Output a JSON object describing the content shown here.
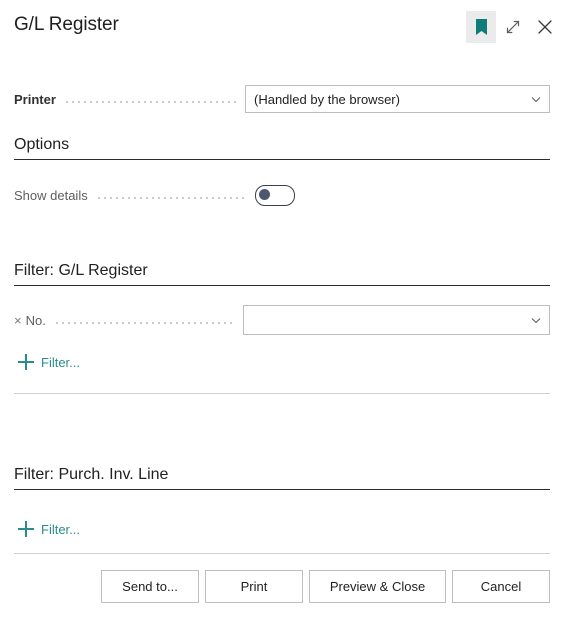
{
  "window": {
    "title": "G/L Register",
    "actions": [
      {
        "name": "bookmark-icon",
        "label": "Bookmark"
      },
      {
        "name": "expand-icon",
        "label": "Expand"
      },
      {
        "name": "close-icon",
        "label": "Close"
      }
    ]
  },
  "printer": {
    "label": "Printer",
    "value": "(Handled by the browser)"
  },
  "options": {
    "heading": "Options",
    "show_details": {
      "label": "Show details",
      "state": "off"
    }
  },
  "filter_gl_register": {
    "heading": "Filter: G/L Register",
    "rows": [
      {
        "clear": "×",
        "label": "No.",
        "value": "",
        "placeholder": ""
      }
    ],
    "add_filter_label": "Filter..."
  },
  "filter_purch_inv_line": {
    "heading": "Filter: Purch. Inv. Line",
    "add_filter_label": "Filter..."
  },
  "footer": {
    "buttons": [
      {
        "name": "send-to-button",
        "label": "Send to..."
      },
      {
        "name": "print-button",
        "label": "Print"
      },
      {
        "name": "preview-close-button",
        "label": "Preview & Close"
      },
      {
        "name": "cancel-button",
        "label": "Cancel"
      }
    ]
  },
  "colors": {
    "accent_teal": "#2a8c8c",
    "bookmark_bg": "#ebebeb",
    "toggle_knob": "#4c566e",
    "rule_dark": "#2b2b2b",
    "rule_light": "#d2d0ce",
    "border": "#bdbdbd"
  }
}
